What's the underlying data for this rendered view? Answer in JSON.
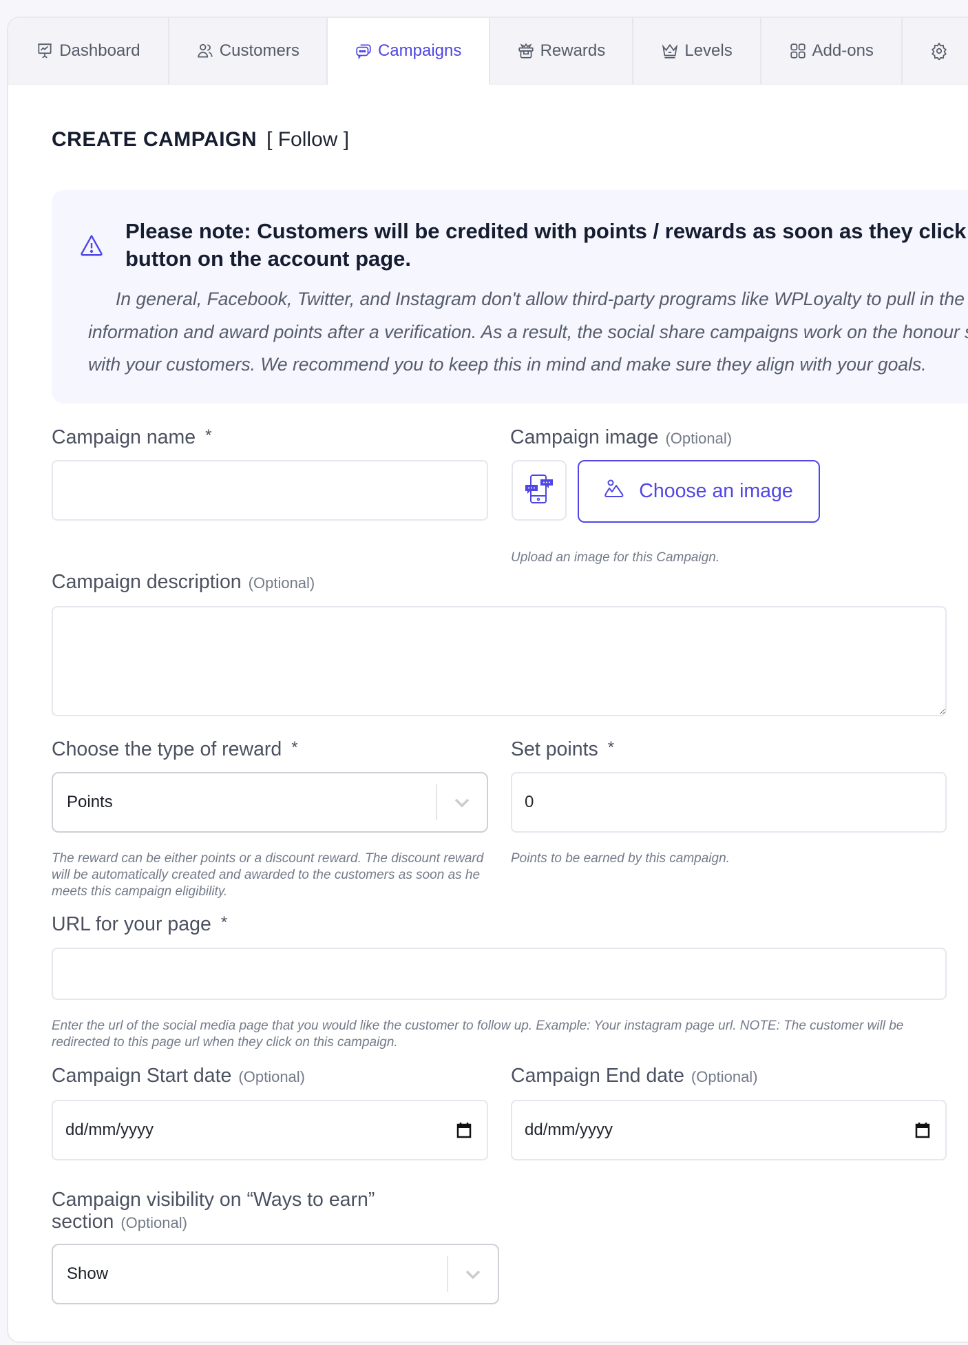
{
  "tabs": [
    {
      "label": "Dashboard",
      "icon": "presentation-chart-icon",
      "active": false
    },
    {
      "label": "Customers",
      "icon": "users-icon",
      "active": false
    },
    {
      "label": "Campaigns",
      "icon": "chat-bubbles-icon",
      "active": true
    },
    {
      "label": "Rewards",
      "icon": "gift-icon",
      "active": false
    },
    {
      "label": "Levels",
      "icon": "crown-icon",
      "active": false
    },
    {
      "label": "Add-ons",
      "icon": "grid-icon",
      "active": false
    },
    {
      "label": "",
      "icon": "gear-icon",
      "active": false
    }
  ],
  "page": {
    "title": "CREATE CAMPAIGN",
    "subtitle": "[ Follow ]"
  },
  "note": {
    "icon": "warning-triangle-icon",
    "heading": "Please note: Customers will be credited with points / rewards as soon as they click the follow button on the account page.",
    "body": "In general, Facebook, Twitter, and Instagram don't allow third-party programs like WPLoyalty to pull in the information and award points after a verification. As a result, the social share campaigns work on the honour system with your customers. We recommend you to keep this in mind and make sure they align with your goals."
  },
  "form": {
    "campaign_name": {
      "label": "Campaign name",
      "required": "*",
      "value": ""
    },
    "campaign_image": {
      "label": "Campaign image",
      "optional": "(Optional)",
      "button_label": "Choose an image",
      "helper": "Upload an image for this Campaign."
    },
    "campaign_description": {
      "label": "Campaign description",
      "optional": "(Optional)",
      "value": ""
    },
    "reward_type": {
      "label": "Choose the type of reward",
      "required": "*",
      "selected": "Points",
      "helper": "The reward can be either points or a discount reward. The discount reward will be automatically created and awarded to the customers as soon as he meets this campaign eligibility."
    },
    "set_points": {
      "label": "Set points",
      "required": "*",
      "value": "0",
      "helper": "Points to be earned by this campaign."
    },
    "url": {
      "label": "URL for your page",
      "required": "*",
      "value": "",
      "helper": "Enter the url of the social media page that you would like the customer to follow up. Example: Your instagram page url. NOTE: The customer will be redirected to this page url when they click on this campaign."
    },
    "start_date": {
      "label": "Campaign Start date",
      "optional": "(Optional)",
      "placeholder": "dd/mm/yyyy"
    },
    "end_date": {
      "label": "Campaign End date",
      "optional": "(Optional)",
      "placeholder": "dd/mm/yyyy"
    },
    "visibility": {
      "label_line1": "Campaign visibility on “Ways to earn”",
      "label_line2": "section",
      "optional": "(Optional)",
      "selected": "Show"
    }
  },
  "colors": {
    "accent": "#4f46e5",
    "heading": "#161d30",
    "note_bg": "#f5f6fe",
    "tab_bg": "#f3f3f8"
  }
}
